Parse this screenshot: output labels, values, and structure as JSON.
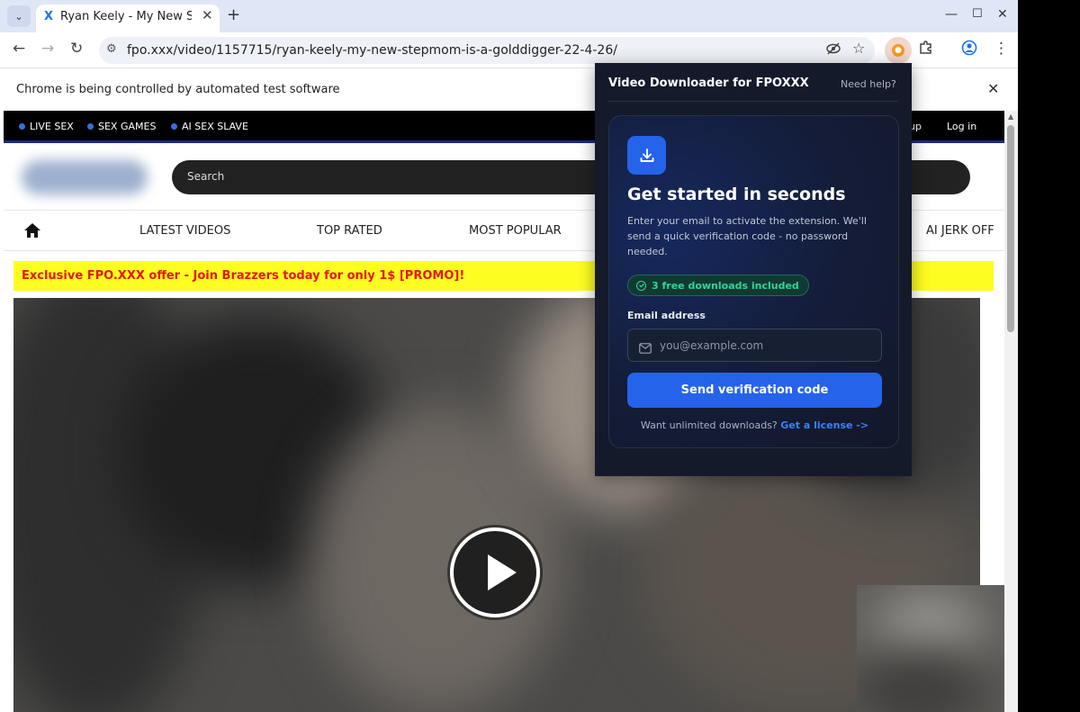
{
  "browser": {
    "tab_title": "Ryan Keely - My New Stepmom",
    "tab_favicon": "X",
    "url": "fpo.xxx/video/1157715/ryan-keely-my-new-stepmom-is-a-golddigger-22-4-26/",
    "infobar_text": "Chrome is being controlled by automated test software"
  },
  "site": {
    "topbar_items": [
      "LIVE SEX",
      "SEX GAMES",
      "AI SEX SLAVE"
    ],
    "topbar_right": [
      "up",
      "Log in"
    ],
    "search_placeholder": "Search",
    "nav_items": [
      "LATEST VIDEOS",
      "TOP RATED",
      "MOST POPULAR",
      "AI JERK OFF"
    ],
    "promo_text": "Exclusive FPO.XXX offer - Join Brazzers today for only 1$ [PROMO]!"
  },
  "popup": {
    "title": "Video Downloader for FPOXXX",
    "help_link": "Need help?",
    "heading": "Get started in seconds",
    "description": "Enter your email to activate the extension. We'll send a quick verification code - no password needed.",
    "badge": "3 free downloads included",
    "email_label": "Email address",
    "email_placeholder": "you@example.com",
    "send_button": "Send verification code",
    "license_prompt": "Want unlimited downloads?",
    "license_link": "Get a license ->"
  },
  "colors": {
    "accent_blue": "#2563eb",
    "promo_yellow": "#fdfd22",
    "promo_red": "#e8170b",
    "badge_green": "#34d399",
    "popup_bg": "#141a2a"
  }
}
